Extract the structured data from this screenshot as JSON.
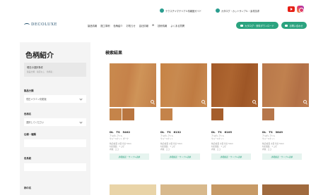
{
  "utility": {
    "items": [
      "テクスチャマテリアル情報館ガイド",
      "カタログ・カットサンプル・素材請求"
    ]
  },
  "header": {
    "logo_text": "DECOLUXE",
    "logo_tag": "DECORATIVE",
    "nav": [
      "製品情報",
      "施工事例",
      "色柄紹介",
      "お知らせ",
      "会社情報",
      "IR",
      "技術情報",
      "よくある質問"
    ],
    "cta_primary": "カタログ・資料ダウンロード",
    "cta_secondary": "お問い合わせ"
  },
  "sidebar": {
    "title": "色柄紹介",
    "chosen_title": "現在の選択条件",
    "chosen_sub": "製品分類：指定なし　色柄名：",
    "filters": [
      {
        "label": "製品分類",
        "value": "低圧メラミン化粧板"
      },
      {
        "label": "色柄名",
        "value": "選択してください"
      },
      {
        "label": "仕様・種類",
        "value": ""
      },
      {
        "label": "色系統",
        "value": ""
      },
      {
        "label": "柄の名",
        "value": ""
      }
    ]
  },
  "main": {
    "title": "検索結果",
    "detail_label": "詳細確認・サンプル請求",
    "cards": [
      {
        "code": "DL　TS　5402",
        "line1": "アルダレアドル",
        "line2": "ウォールナット ダーク",
        "line3": "特記/縦目 木目 色合 5mm",
        "line4": "対応製品：ミュゼ",
        "line5": "内容：エコ"
      },
      {
        "code": "DL　TS　6132",
        "line1": "アルダレアドル",
        "line2": "ウォールナット",
        "line3": "特記/縦目 木目 色合 5mm",
        "line4": "対応製品：ミュゼ",
        "line5": "内容：エコ"
      },
      {
        "code": "DL　TS　6105",
        "line1": "アルダレアドル",
        "line2": "ウォールナット",
        "line3": "特記/縦目 木目 色合 5mm",
        "line4": "対応製品：ミュゼ",
        "line5": "内容：エコ"
      },
      {
        "code": "DL　TS　3849",
        "line1": "アルダレアドル",
        "line2": "ウォールナット",
        "line3": "特記/縦目 木目 色合 5mm",
        "line4": "対応製品：ミュゼ",
        "line5": "内容：エコ"
      }
    ]
  },
  "colors": {
    "accent": "#2ba37f",
    "swatch1": "#c8874a",
    "swatch2": "#c27c45",
    "swatch3": "#a8602e",
    "swatch4": "#b9774a"
  }
}
